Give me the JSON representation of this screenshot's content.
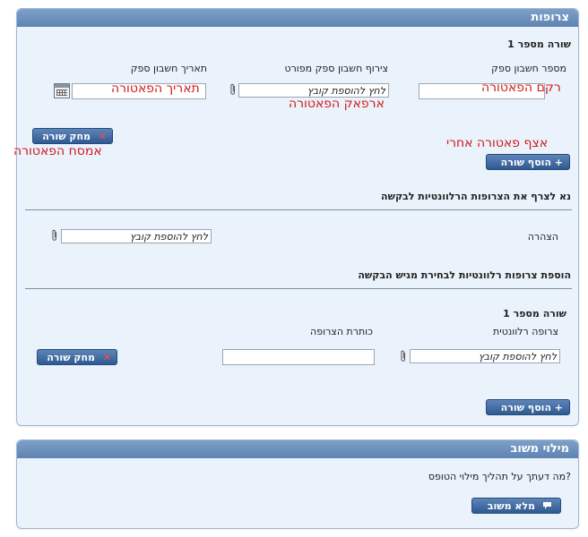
{
  "attachments_panel": {
    "title": "צרופות",
    "row_title": "שורה מספר 1",
    "col_invoice_number": "מספר חשבון ספק",
    "col_invoice_attach": "צירוף חשבון ספק מפורט",
    "col_invoice_date": "תאריך חשבון ספק",
    "invoice_number_annotation": "רקם הפאטורה",
    "invoice_attach_annotation": "ארפאק הפאטורה",
    "invoice_date_annotation": "תאריך הפאטורה",
    "file_placeholder": "לחץ להוספת קובץ",
    "delete_row_label": "מחק שורה",
    "delete_annotation": "אמסח הפאטורה",
    "add_row_label": "הוסף שורה",
    "add_annotation": "אצף  פאטורה אחרי",
    "section1_heading": "נא לצרף את הצרופות הרלוונטיות לבקשה",
    "declaration_label": "הצהרה",
    "section2_heading": "הוספת צרופות רלוונטיות לבחירת מגיש הבקשה",
    "row2_title": "שורה מספר 1",
    "col_relevant_attachment": "צרופה רלוונטית",
    "col_attachment_title": "כותרת הצרופה",
    "delete_row2_label": "מחק שורה",
    "add_row2_label": "הוסף שורה"
  },
  "feedback_panel": {
    "title": "מילוי משוב",
    "question": "מה דעתך על תהליך מילוי הטופס?",
    "fill_button_label": "מלא משוב"
  }
}
